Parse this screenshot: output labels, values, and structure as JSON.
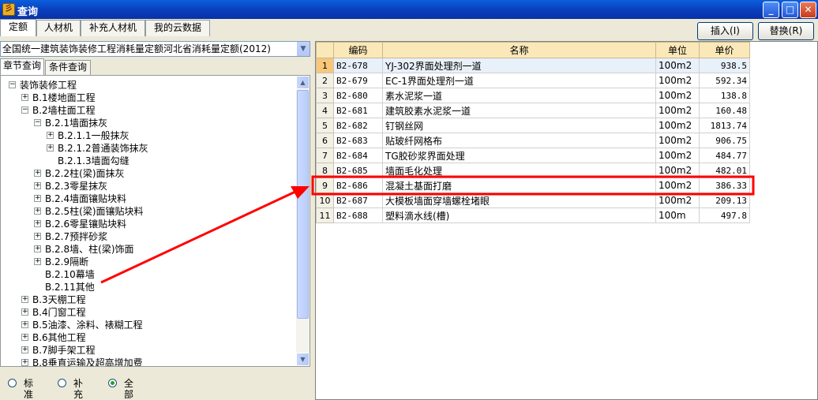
{
  "window": {
    "title": "查询",
    "app_icon_glyph": "彡"
  },
  "tabs": [
    "定额",
    "人材机",
    "补充人材机",
    "我的云数据"
  ],
  "buttons": {
    "insert": "插入(I)",
    "replace": "替换(R)"
  },
  "quota_book": "全国统一建筑装饰装修工程消耗量定额河北省消耗量定额(2012)",
  "search_tabs": [
    "章节查询",
    "条件查询"
  ],
  "tree": [
    {
      "label": "装饰装修工程",
      "expander": "−"
    },
    {
      "label": "B.1楼地面工程",
      "expander": "+"
    },
    {
      "label": "B.2墙柱面工程",
      "expander": "−"
    },
    {
      "label": "B.2.1墙面抹灰",
      "expander": "−"
    },
    {
      "label": "B.2.1.1一般抹灰",
      "expander": "+"
    },
    {
      "label": "B.2.1.2普通装饰抹灰",
      "expander": "+"
    },
    {
      "label": "B.2.1.3墙面勾缝",
      "expander": ""
    },
    {
      "label": "B.2.2柱(梁)面抹灰",
      "expander": "+"
    },
    {
      "label": "B.2.3零星抹灰",
      "expander": "+"
    },
    {
      "label": "B.2.4墙面镶贴块料",
      "expander": "+"
    },
    {
      "label": "B.2.5柱(梁)面镶贴块料",
      "expander": "+"
    },
    {
      "label": "B.2.6零星镶贴块料",
      "expander": "+"
    },
    {
      "label": "B.2.7预拌砂浆",
      "expander": "+"
    },
    {
      "label": "B.2.8墙、柱(梁)饰面",
      "expander": "+"
    },
    {
      "label": "B.2.9隔断",
      "expander": "+"
    },
    {
      "label": "B.2.10幕墙",
      "expander": ""
    },
    {
      "label": "B.2.11其他",
      "expander": ""
    },
    {
      "label": "B.3天棚工程",
      "expander": "+"
    },
    {
      "label": "B.4门窗工程",
      "expander": "+"
    },
    {
      "label": "B.5油漆、涂料、裱糊工程",
      "expander": "+"
    },
    {
      "label": "B.6其他工程",
      "expander": "+"
    },
    {
      "label": "B.7脚手架工程",
      "expander": "+"
    },
    {
      "label": "B.8垂直运输及超高增加费",
      "expander": "+"
    }
  ],
  "filter": {
    "options": [
      "标准",
      "补充",
      "全部"
    ],
    "selected": "全部"
  },
  "grid": {
    "headers": [
      "",
      "编码",
      "名称",
      "单位",
      "单价"
    ],
    "rows": [
      {
        "no": "1",
        "code": "B2-678",
        "name": "YJ-302界面处理剂一道",
        "unit": "100m2",
        "price": "938.5"
      },
      {
        "no": "2",
        "code": "B2-679",
        "name": "EC-1界面处理剂一道",
        "unit": "100m2",
        "price": "592.34"
      },
      {
        "no": "3",
        "code": "B2-680",
        "name": "素水泥浆一道",
        "unit": "100m2",
        "price": "138.8"
      },
      {
        "no": "4",
        "code": "B2-681",
        "name": "建筑胶素水泥浆一道",
        "unit": "100m2",
        "price": "160.48"
      },
      {
        "no": "5",
        "code": "B2-682",
        "name": "钉钢丝网",
        "unit": "100m2",
        "price": "1813.74"
      },
      {
        "no": "6",
        "code": "B2-683",
        "name": "贴玻纤网格布",
        "unit": "100m2",
        "price": "906.75"
      },
      {
        "no": "7",
        "code": "B2-684",
        "name": "TG胶砂浆界面处理",
        "unit": "100m2",
        "price": "484.77"
      },
      {
        "no": "8",
        "code": "B2-685",
        "name": "墙面毛化处理",
        "unit": "100m2",
        "price": "482.01"
      },
      {
        "no": "9",
        "code": "B2-686",
        "name": "混凝土基面打磨",
        "unit": "100m2",
        "price": "386.33"
      },
      {
        "no": "10",
        "code": "B2-687",
        "name": "大模板墙面穿墙螺栓堵眼",
        "unit": "100m2",
        "price": "209.13"
      },
      {
        "no": "11",
        "code": "B2-688",
        "name": "塑料滴水线(槽)",
        "unit": "100m",
        "price": "497.8"
      }
    ],
    "selected_row": 1
  },
  "annotation": {
    "color": "#ff0000",
    "highlighted_row": "9"
  },
  "colors": {
    "titlebar": "#0a3fbf",
    "header": "#fbe8b8",
    "selected_row_marker": "#f8c779",
    "annotation": "#ff0000"
  }
}
